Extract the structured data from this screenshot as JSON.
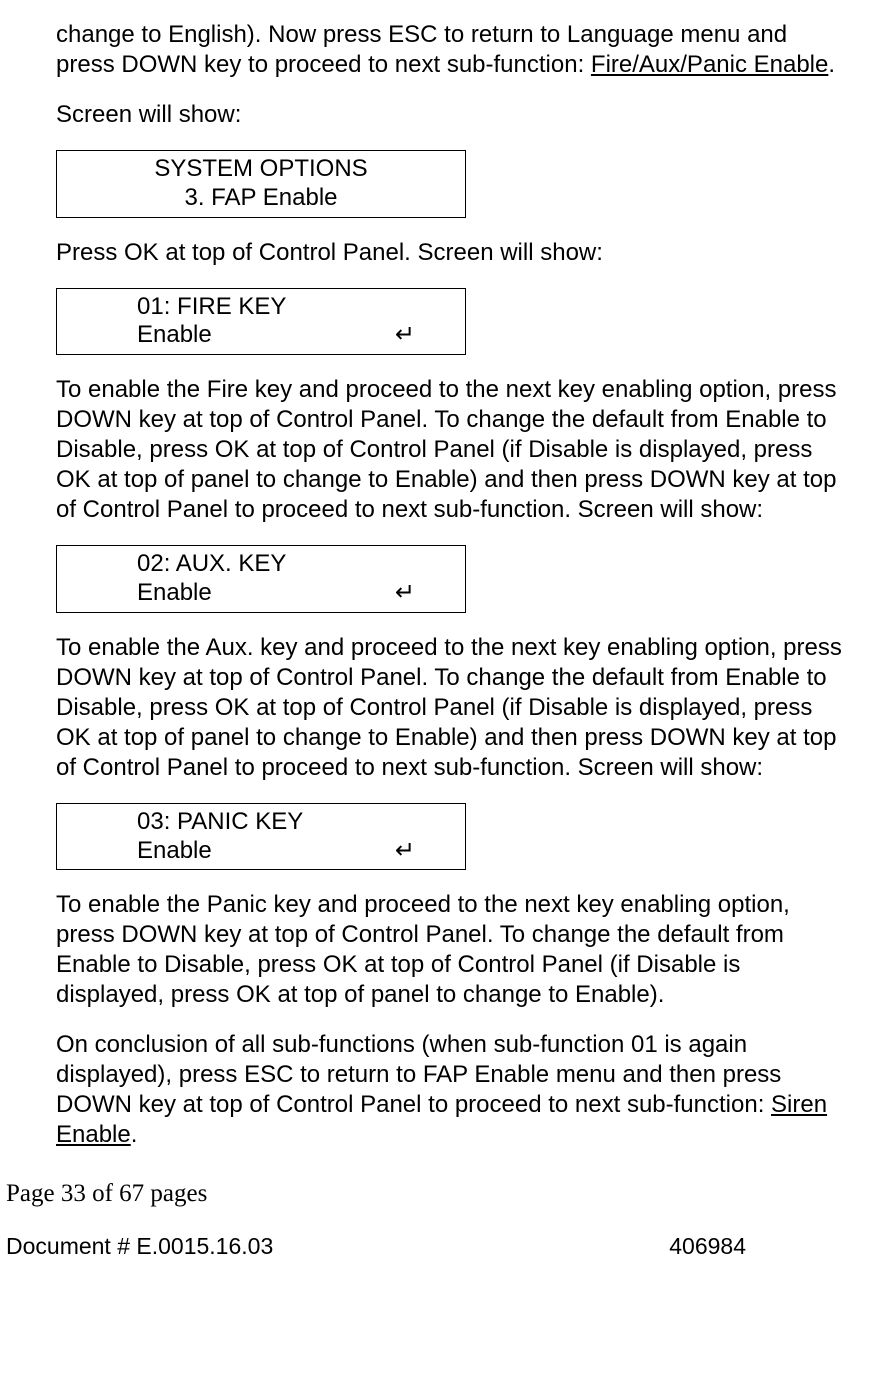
{
  "intro": {
    "part1": "change to English). Now press ESC to return to Language menu and press DOWN key to proceed to next sub-function: ",
    "link": "Fire/Aux/Panic Enable",
    "part2": "."
  },
  "p_screen1": "Screen will show:",
  "box1": {
    "line1": "SYSTEM OPTIONS",
    "line2": "3. FAP Enable"
  },
  "p_press_ok": "Press OK at top of Control Panel. Screen will show:",
  "box2": {
    "line1": "01: FIRE KEY",
    "line2_left": "Enable",
    "line2_right": "↵"
  },
  "p_fire": "To enable the Fire key and proceed to the next key enabling option, press DOWN key at top of Control Panel. To change the default from Enable to Disable, press OK at top of Control Panel (if Disable is displayed, press OK at top of panel to change to Enable) and then press DOWN key at top of Control Panel to proceed to next sub-function. Screen will show:",
  "box3": {
    "line1": "02: AUX. KEY",
    "line2_left": "Enable",
    "line2_right": "↵"
  },
  "p_aux": "To enable the Aux. key and proceed to the next key enabling option, press DOWN key at top of Control Panel. To change the default from Enable to Disable, press OK at top of Control Panel (if Disable is displayed, press OK at top of panel to change to Enable) and then press DOWN key at top of Control Panel to proceed to next sub-function. Screen will show:",
  "box4": {
    "line1": "03: PANIC KEY",
    "line2_left": "Enable",
    "line2_right": "↵"
  },
  "p_panic": "To enable the Panic key and proceed to the next key enabling option, press DOWN key at top of Control Panel. To change the default from Enable to Disable, press OK at top of Control Panel (if Disable is displayed, press OK at top of panel to change to Enable).",
  "p_conclusion": {
    "part1": "On conclusion of all sub-functions (when sub-function 01 is again displayed), press ESC to return to FAP Enable menu and then press DOWN key at top of Control Panel to proceed to next sub-function: ",
    "link": "Siren Enable",
    "part2": "."
  },
  "footer_page": "Page 33 of  67 pages",
  "footer_doc": "Document # E.0015.16.03",
  "footer_num": "406984"
}
